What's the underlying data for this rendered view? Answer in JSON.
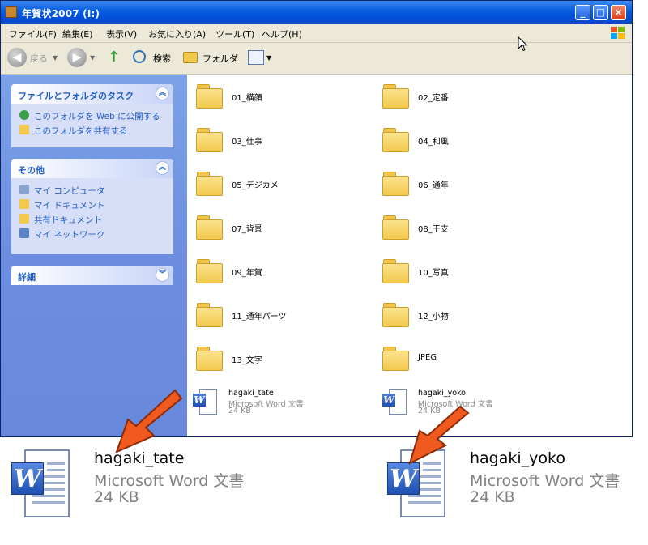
{
  "window": {
    "title": "年賀状2007 (I:)"
  },
  "menu": [
    "ファイル(F)",
    "編集(E)",
    "表示(V)",
    "お気に入り(A)",
    "ツール(T)",
    "ヘルプ(H)"
  ],
  "toolbar": {
    "back_label": "戻る",
    "search_label": "検索",
    "folders_label": "フォルダ"
  },
  "sidebar": {
    "tasks_panel": {
      "title": "ファイルとフォルダのタスク",
      "items": [
        "このフォルダを Web に公開する",
        "このフォルダを共有する"
      ]
    },
    "other_panel": {
      "title": "その他",
      "items": [
        "マイ コンピュータ",
        "マイ ドキュメント",
        "共有ドキュメント",
        "マイ ネットワーク"
      ]
    },
    "details_panel": {
      "title": "詳細"
    }
  },
  "folders": [
    "01_横顔",
    "02_定番",
    "03_仕事",
    "04_和風",
    "05_デジカメ",
    "06_通年",
    "07_背景",
    "08_干支",
    "09_年賀",
    "10_写真",
    "11_通年パーツ",
    "12_小物",
    "13_文字",
    "JPEG"
  ],
  "files": [
    {
      "name": "hagaki_tate",
      "type": "Microsoft Word 文書",
      "size": "24 KB"
    },
    {
      "name": "hagaki_yoko",
      "type": "Microsoft Word 文書",
      "size": "24 KB"
    }
  ],
  "callouts": [
    {
      "name": "hagaki_tate",
      "type": "Microsoft Word 文書",
      "size": "24 KB"
    },
    {
      "name": "hagaki_yoko",
      "type": "Microsoft Word 文書",
      "size": "24 KB"
    }
  ],
  "colors": {
    "titlebar": "#0054e3",
    "sidebar": "#6d8ee0",
    "task_text": "#215dc6",
    "arrow": "#f05a1e",
    "folder": "#f2c94c"
  }
}
